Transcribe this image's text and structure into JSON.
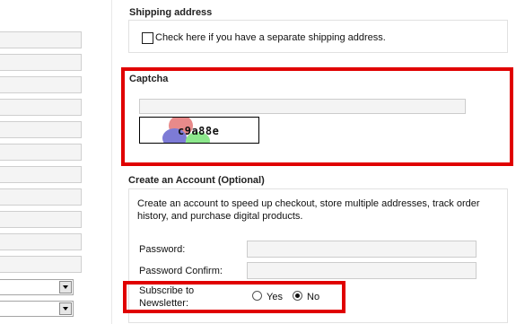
{
  "shipping": {
    "title": "Shipping address",
    "checkbox_label": "Check here if you have a separate shipping address."
  },
  "captcha": {
    "title": "Captcha",
    "input_value": "",
    "code": "c9a88e"
  },
  "account": {
    "title": "Create an Account (Optional)",
    "description_line1": "Create an account to speed up checkout, store multiple addresses, track order",
    "description_line2": "history, and purchase digital products.",
    "password_label": "Password:",
    "password_confirm_label": "Password Confirm:",
    "newsletter_label_line1": "Subscribe to",
    "newsletter_label_line2": "Newsletter:",
    "yes_label": "Yes",
    "no_label": "No",
    "newsletter_selected": "No"
  },
  "colors": {
    "highlight": "#e00000",
    "field_bg": "#f4f4f4"
  }
}
